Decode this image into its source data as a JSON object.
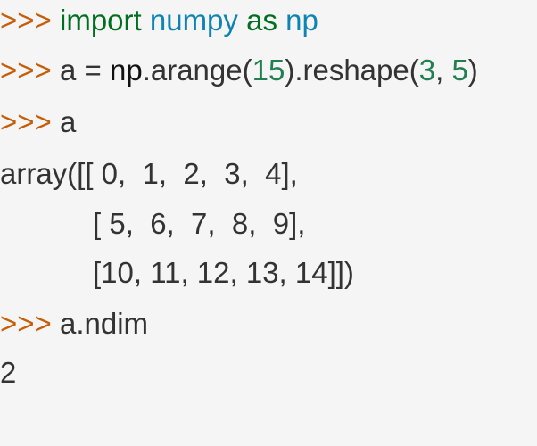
{
  "prompt": ">>>",
  "lines": [
    {
      "kind": "input",
      "parts": [
        {
          "text": "import",
          "cls": "kw"
        },
        {
          "text": " ",
          "cls": "plain"
        },
        {
          "text": "numpy",
          "cls": "mod"
        },
        {
          "text": " ",
          "cls": "plain"
        },
        {
          "text": "as",
          "cls": "kw"
        },
        {
          "text": " ",
          "cls": "plain"
        },
        {
          "text": "np",
          "cls": "mod"
        }
      ]
    },
    {
      "kind": "input",
      "parts": [
        {
          "text": "a",
          "cls": "plain"
        },
        {
          "text": " = ",
          "cls": "plain"
        },
        {
          "text": "np",
          "cls": "nm"
        },
        {
          "text": ".arange(",
          "cls": "plain"
        },
        {
          "text": "15",
          "cls": "num"
        },
        {
          "text": ").reshape(",
          "cls": "plain"
        },
        {
          "text": "3",
          "cls": "num"
        },
        {
          "text": ", ",
          "cls": "plain"
        },
        {
          "text": "5",
          "cls": "num"
        },
        {
          "text": ")",
          "cls": "plain"
        }
      ]
    },
    {
      "kind": "input",
      "parts": [
        {
          "text": "a",
          "cls": "plain"
        }
      ]
    },
    {
      "kind": "output",
      "indent": false,
      "text": "array([[ 0,  1,  2,  3,  4],"
    },
    {
      "kind": "output",
      "indent": true,
      "text": "[ 5,  6,  7,  8,  9],"
    },
    {
      "kind": "output",
      "indent": true,
      "text": "[10, 11, 12, 13, 14]])"
    },
    {
      "kind": "input",
      "parts": [
        {
          "text": "a.ndim",
          "cls": "plain"
        }
      ]
    },
    {
      "kind": "output",
      "indent": false,
      "text": "2"
    }
  ]
}
